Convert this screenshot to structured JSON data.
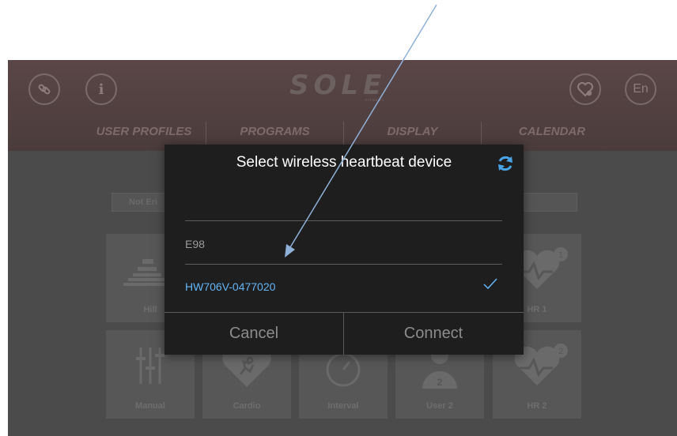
{
  "header": {
    "logo": "SOLE",
    "logo_sub": "FITNESS",
    "lang": "En"
  },
  "tabs": [
    "USER PROFILES",
    "PROGRAMS",
    "DISPLAY",
    "CALENDAR"
  ],
  "filters": {
    "left": "Not Eri"
  },
  "programs": [
    {
      "label": "Hill",
      "icon": "hill-icon"
    },
    {
      "label": "HR 1",
      "icon": "heart-1-icon"
    },
    {
      "label": "Manual",
      "icon": "manual-sliders-icon"
    },
    {
      "label": "Cardio",
      "icon": "cardio-heart-icon"
    },
    {
      "label": "Interval",
      "icon": "interval-gauge-icon"
    },
    {
      "label": "User 2",
      "icon": "user-2-icon"
    },
    {
      "label": "HR 2",
      "icon": "heart-2-icon"
    }
  ],
  "dialog": {
    "title": "Select wireless heartbeat device",
    "devices": [
      {
        "name": "",
        "selected": false
      },
      {
        "name": "E98",
        "selected": false
      },
      {
        "name": "HW706V-0477020",
        "selected": true
      }
    ],
    "cancel": "Cancel",
    "connect": "Connect"
  },
  "colors": {
    "accent": "#64b5f6",
    "dialog_bg": "#1e1e1e",
    "arrow": "#8fb0d8"
  }
}
